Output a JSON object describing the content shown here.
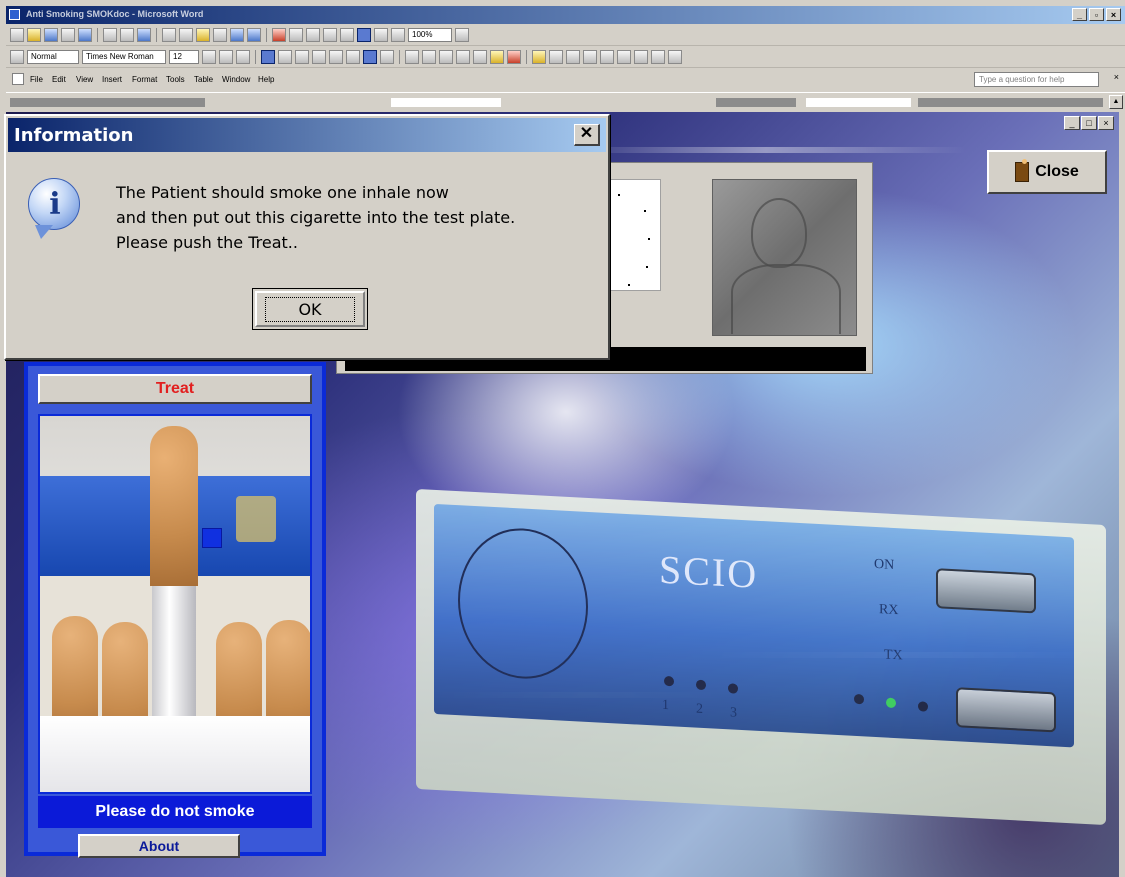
{
  "window": {
    "title": "Anti Smoking SMOKdoc - Microsoft Word",
    "controls": [
      "_",
      "▫",
      "×"
    ]
  },
  "formatting": {
    "style": "Normal",
    "font": "Times New Roman",
    "size": "12",
    "zoom": "100%"
  },
  "menubar": {
    "items": [
      "File",
      "Edit",
      "View",
      "Insert",
      "Format",
      "Tools",
      "Table",
      "Window",
      "Help"
    ],
    "help_placeholder": "Type a question for help",
    "doc_close": "×"
  },
  "app": {
    "window_controls": [
      "_",
      "□",
      "×"
    ],
    "close_label": "Close",
    "treat_label": "Treat",
    "no_smoke_label": "Please do not smoke",
    "about_label": "About",
    "device_logo": "SCIO",
    "led_labels": [
      "ON",
      "RX",
      "TX"
    ],
    "led_numbers": [
      "1",
      "2",
      "3"
    ]
  },
  "dialog": {
    "title": "Information",
    "close_glyph": "✕",
    "icon_glyph": "i",
    "message_lines": [
      "The Patient should smoke one inhale now",
      "and then put out this cigarette into the test plate.",
      "Please push the Treat.."
    ],
    "ok_label": "OK"
  },
  "colors": {
    "titlebar_start": "#0a246a",
    "titlebar_end": "#a6caf0",
    "panel_border": "#0a2ad8",
    "treat_text": "#e21f1f",
    "no_smoke_bg": "#0b1ad8"
  },
  "icons": {
    "app": "word-icon",
    "info": "information-icon",
    "close_door": "door-exit-icon"
  }
}
